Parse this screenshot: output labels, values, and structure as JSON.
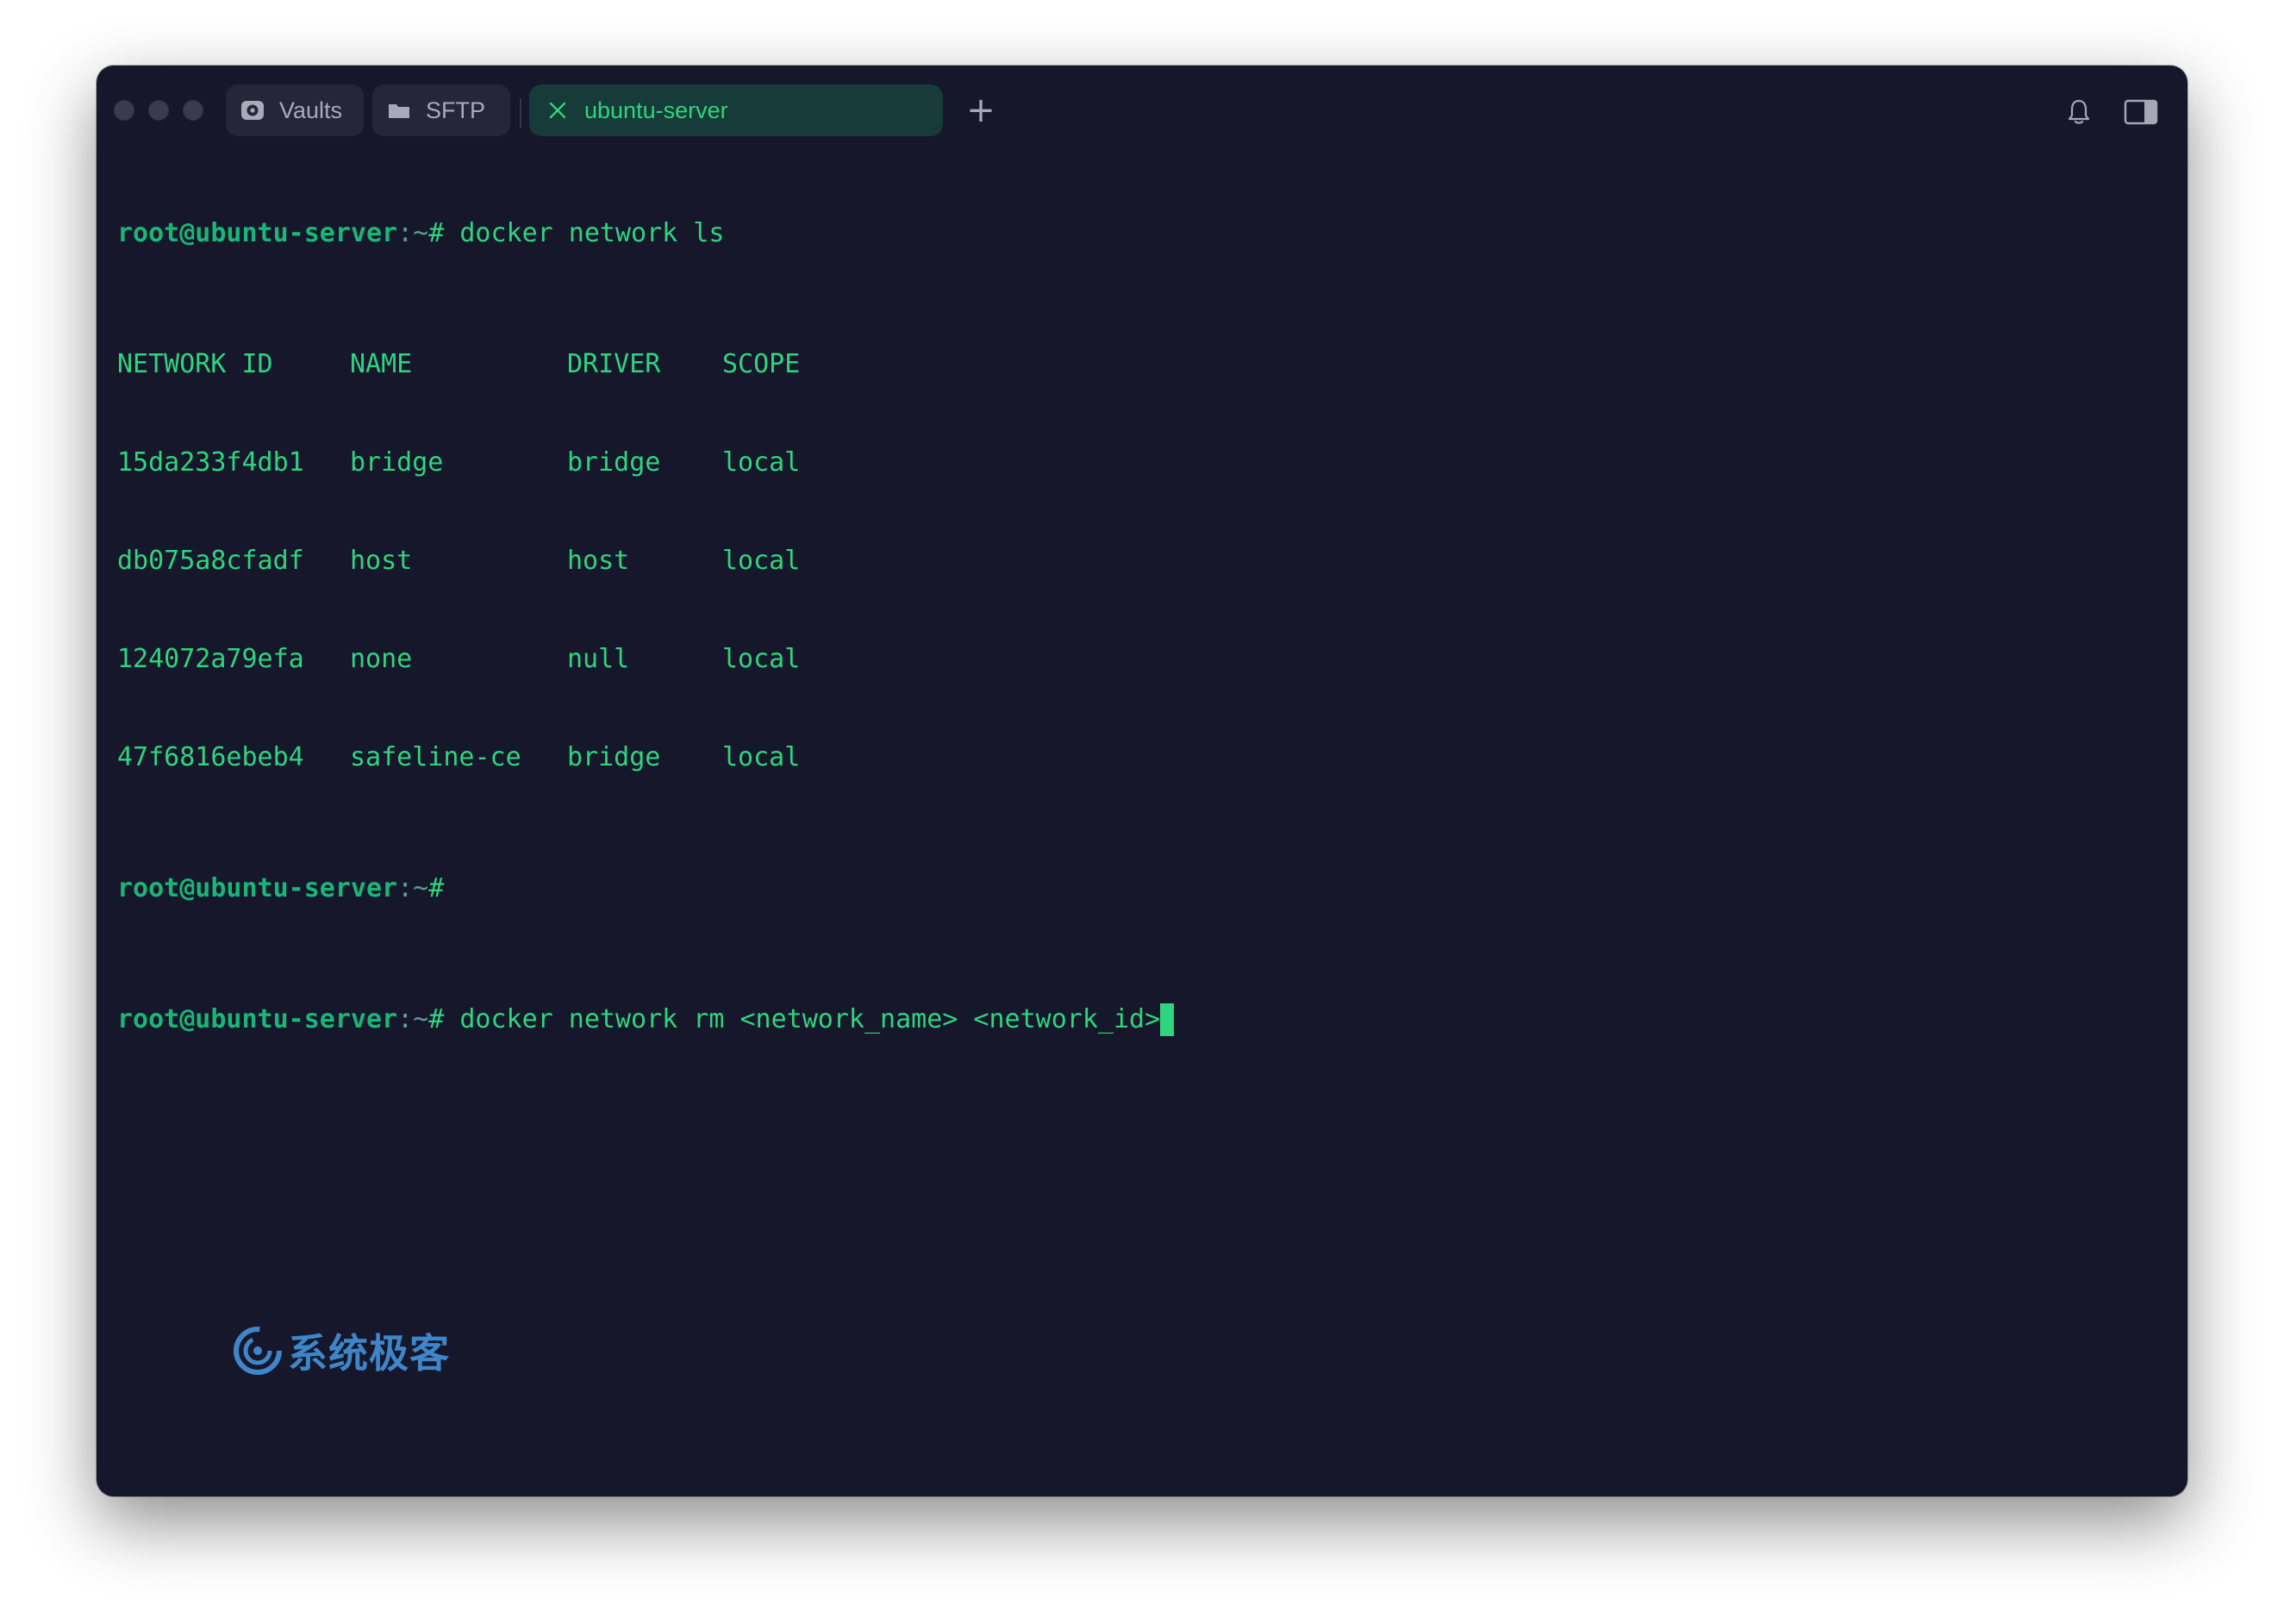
{
  "tabs": [
    {
      "label": "Vaults",
      "icon": "vault-icon",
      "active": false
    },
    {
      "label": "SFTP",
      "icon": "folder-icon",
      "active": false
    },
    {
      "label": "ubuntu-server",
      "icon": "close-icon",
      "active": true
    }
  ],
  "new_tab_label": "+",
  "terminal": {
    "prompt_user": "root@ubuntu-server",
    "prompt_path": ":~",
    "prompt_symbol": "#",
    "command1": " docker network ls",
    "table": {
      "headers": [
        "NETWORK ID",
        "NAME",
        "DRIVER",
        "SCOPE"
      ],
      "rows": [
        [
          "15da233f4db1",
          "bridge",
          "bridge",
          "local"
        ],
        [
          "db075a8cfadf",
          "host",
          "host",
          "local"
        ],
        [
          "124072a79efa",
          "none",
          "null",
          "local"
        ],
        [
          "47f6816ebeb4",
          "safeline-ce",
          "bridge",
          "local"
        ]
      ]
    },
    "command3": " docker network rm <network_name> <network_id>"
  },
  "watermark": {
    "text": "系统极客"
  },
  "colors": {
    "window_bg": "#16172b",
    "terminal_text": "#2fd47e",
    "prompt_user": "#19b677",
    "active_tab_bg": "#163b39",
    "watermark": "#3e86c9"
  }
}
